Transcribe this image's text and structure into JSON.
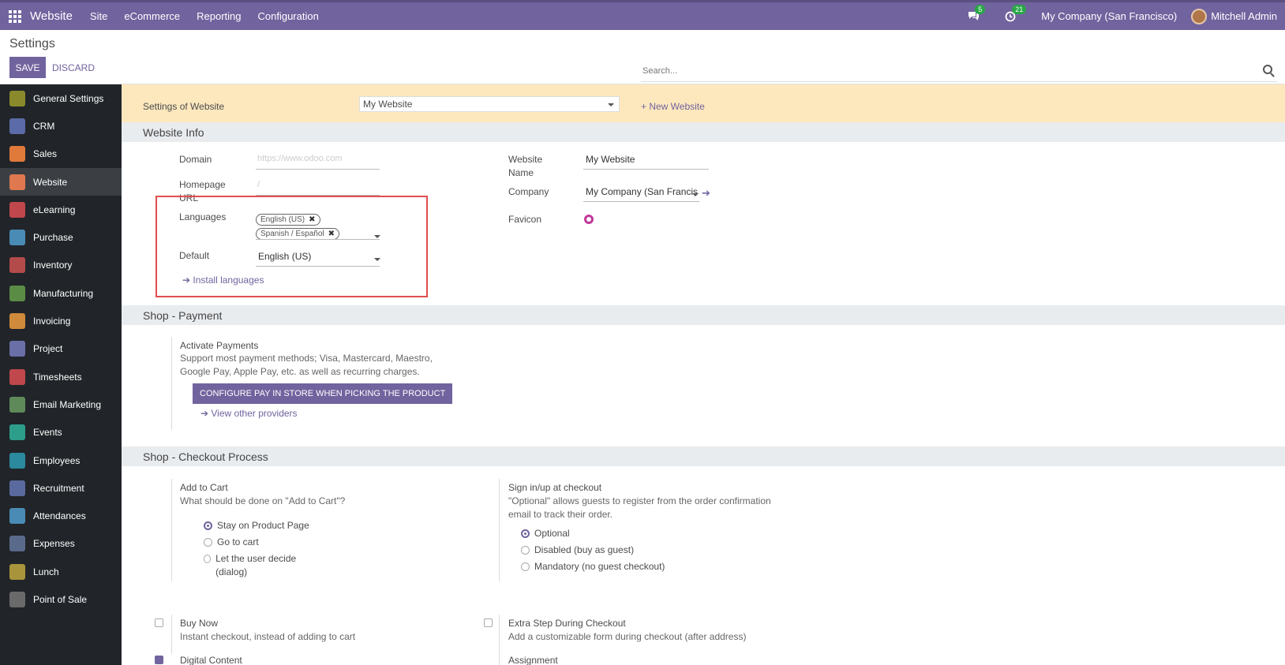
{
  "navbar": {
    "brand": "Website",
    "menus": [
      "Site",
      "eCommerce",
      "Reporting",
      "Configuration"
    ],
    "messages_count": "5",
    "activities_count": "21",
    "company": "My Company (San Francisco)",
    "user": "Mitchell Admin"
  },
  "control": {
    "title": "Settings",
    "save_label": "SAVE",
    "discard_label": "DISCARD",
    "search_placeholder": "Search..."
  },
  "sidebar": {
    "items": [
      {
        "label": "General Settings",
        "icon": "gear-icon",
        "color": "#8a8a2c"
      },
      {
        "label": "CRM",
        "icon": "handshake-icon",
        "color": "#5b6aa8"
      },
      {
        "label": "Sales",
        "icon": "chart-icon",
        "color": "#e07a3b"
      },
      {
        "label": "Website",
        "icon": "globe-icon",
        "color": "#e0784f"
      },
      {
        "label": "eLearning",
        "icon": "elearning-icon",
        "color": "#c0474b"
      },
      {
        "label": "Purchase",
        "icon": "purchase-icon",
        "color": "#4a8bb5"
      },
      {
        "label": "Inventory",
        "icon": "inventory-icon",
        "color": "#b44b4b"
      },
      {
        "label": "Manufacturing",
        "icon": "wrench-icon",
        "color": "#5a8c46"
      },
      {
        "label": "Invoicing",
        "icon": "invoice-icon",
        "color": "#d08a3b"
      },
      {
        "label": "Project",
        "icon": "puzzle-icon",
        "color": "#6a6fa8"
      },
      {
        "label": "Timesheets",
        "icon": "stopwatch-icon",
        "color": "#c0474b"
      },
      {
        "label": "Email Marketing",
        "icon": "megaphone-icon",
        "color": "#5e8a5a"
      },
      {
        "label": "Events",
        "icon": "ticket-icon",
        "color": "#2c9e8a"
      },
      {
        "label": "Employees",
        "icon": "people-icon",
        "color": "#2c8a9e"
      },
      {
        "label": "Recruitment",
        "icon": "magnifier-icon",
        "color": "#5a6a9e"
      },
      {
        "label": "Attendances",
        "icon": "attendance-icon",
        "color": "#4a8bb5"
      },
      {
        "label": "Expenses",
        "icon": "expenses-icon",
        "color": "#5a6a8a"
      },
      {
        "label": "Lunch",
        "icon": "fork-knife-icon",
        "color": "#a8943b"
      },
      {
        "label": "Point of Sale",
        "icon": "store-icon",
        "color": "#6a6a6a"
      }
    ],
    "active_index": 3
  },
  "website_bar": {
    "label": "Settings of Website",
    "selected": "My Website",
    "new_label": "+ New Website"
  },
  "website_info": {
    "heading": "Website Info",
    "domain_label": "Domain",
    "domain_placeholder": "https://www.odoo.com",
    "homepage_label": "Homepage URL",
    "homepage_placeholder": "/",
    "languages_label": "Languages",
    "languages": [
      "English (US)",
      "Spanish / Español"
    ],
    "default_label": "Default",
    "default_value": "English (US)",
    "install_link": "Install languages",
    "website_name_label": "Website Name",
    "website_name": "My Website",
    "company_label": "Company",
    "company_value": "My Company (San Francis",
    "favicon_label": "Favicon"
  },
  "payment": {
    "heading": "Shop - Payment",
    "title": "Activate Payments",
    "desc": "Support most payment methods; Visa, Mastercard, Maestro, Google Pay, Apple Pay, etc. as well as recurring charges.",
    "configure_button": "CONFIGURE PAY IN STORE WHEN PICKING THE PRODUCT",
    "providers_link": "View other providers"
  },
  "checkout": {
    "heading": "Shop - Checkout Process",
    "add_to_cart_title": "Add to Cart",
    "add_to_cart_desc": "What should be done on \"Add to Cart\"?",
    "add_to_cart_options": [
      "Stay on Product Page",
      "Go to cart",
      "Let the user decide (dialog)"
    ],
    "signin_title": "Sign in/up at checkout",
    "signin_desc": "\"Optional\" allows guests to register from the order confirmation email to track their order.",
    "signin_options": [
      "Optional",
      "Disabled (buy as guest)",
      "Mandatory (no guest checkout)"
    ],
    "buy_now_title": "Buy Now",
    "buy_now_desc": "Instant checkout, instead of adding to cart",
    "extra_step_title": "Extra Step During Checkout",
    "extra_step_desc": "Add a customizable form during checkout (after address)",
    "digital_title": "Digital Content",
    "assignment_title": "Assignment"
  }
}
